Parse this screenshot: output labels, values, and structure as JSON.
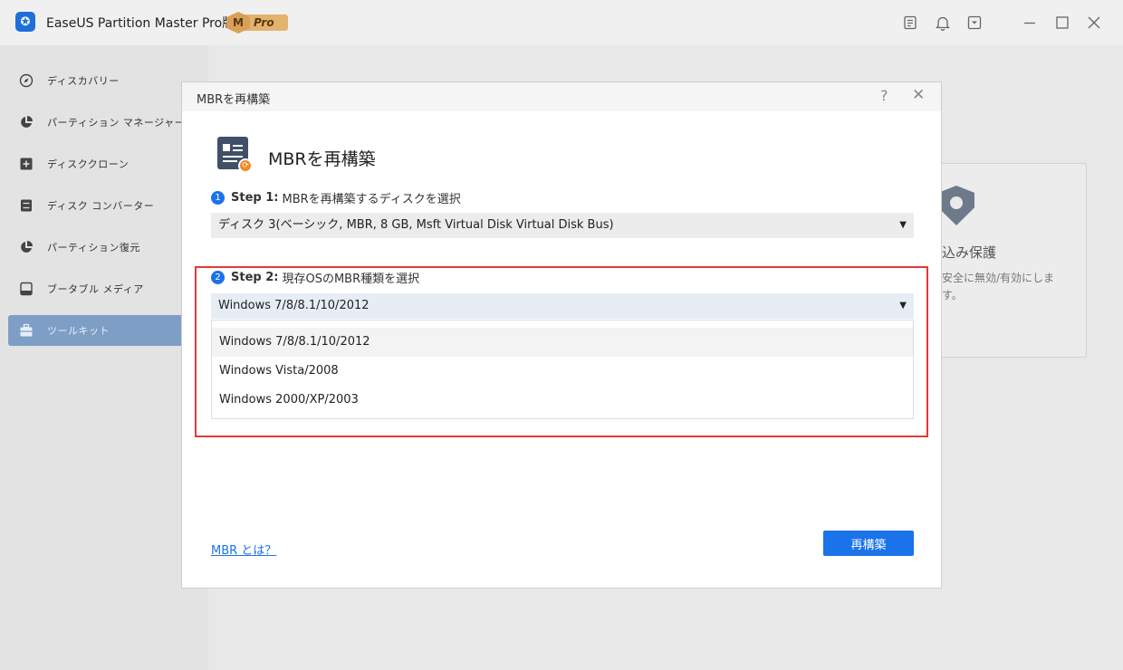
{
  "app": {
    "title": "EaseUS Partition Master Pro版",
    "badge_m": "M",
    "badge_pro": "Pro"
  },
  "sidebar": {
    "items": [
      {
        "label": "ディスカバリー",
        "icon": "compass-icon"
      },
      {
        "label": "パーティション マネージャー",
        "icon": "pie-chart-icon"
      },
      {
        "label": "ディスククローン",
        "icon": "plus-square-icon"
      },
      {
        "label": "ディスク コンバーター",
        "icon": "disk-convert-icon"
      },
      {
        "label": "パーティション復元",
        "icon": "pie-restore-icon"
      },
      {
        "label": "ブータブル メディア",
        "icon": "bootable-media-icon"
      },
      {
        "label": "ツールキット",
        "icon": "toolbox-icon",
        "active": true
      }
    ]
  },
  "background_card": {
    "title": "込み保護",
    "desc": "安全に無効/有効にします。"
  },
  "dialog": {
    "window_title": "MBRを再構築",
    "heading": "MBRを再構築",
    "step1": {
      "num": "1",
      "label": "Step 1:",
      "text": "MBRを再構築するディスクを選択",
      "value": "ディスク 3(ベーシック, MBR, 8 GB, Msft Virtual Disk Virtual Disk Bus)"
    },
    "step2": {
      "num": "2",
      "label": "Step 2:",
      "text": "現存OSのMBR種類を選択",
      "value": "Windows 7/8/8.1/10/2012",
      "options": [
        "Windows 7/8/8.1/10/2012",
        "Windows Vista/2008",
        "Windows 2000/XP/2003"
      ]
    },
    "link": "MBR とは？",
    "button": "再構築"
  },
  "colors": {
    "accent": "#1a73e8",
    "highlight_border": "#e53935",
    "sidebar_active": "#7e9ec6"
  }
}
